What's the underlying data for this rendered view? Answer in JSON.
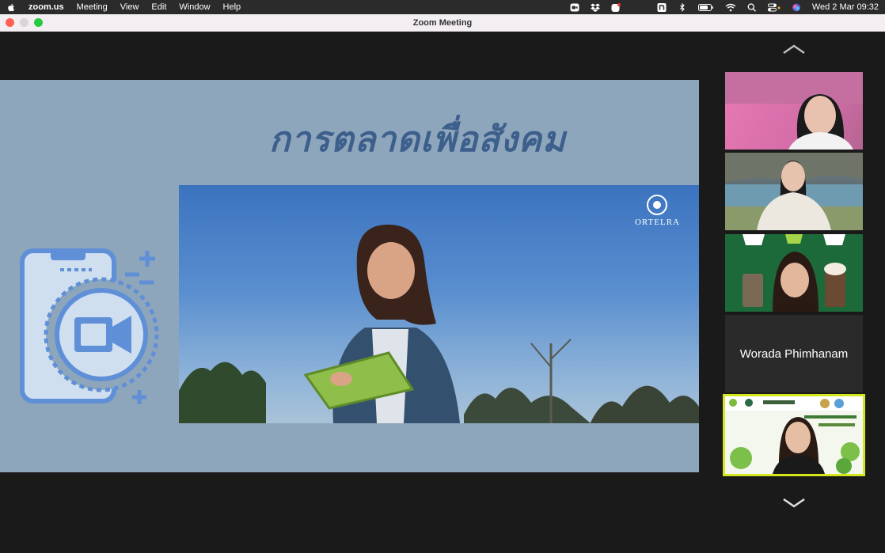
{
  "menubar": {
    "app_name": "zoom.us",
    "menus": [
      "Meeting",
      "View",
      "Edit",
      "Window",
      "Help"
    ],
    "clock": "Wed 2 Mar  09:32"
  },
  "window": {
    "title": "Zoom Meeting"
  },
  "shared_screen": {
    "title": "การตลาดเพื่อสังคม",
    "brand": "ORTELRA"
  },
  "participants": {
    "name_tile": "Worada Phimhanam"
  },
  "colors": {
    "slide_bg": "#8ea6bc",
    "title_color": "#3d5f8c",
    "active_speaker_border": "#d4e61c"
  }
}
